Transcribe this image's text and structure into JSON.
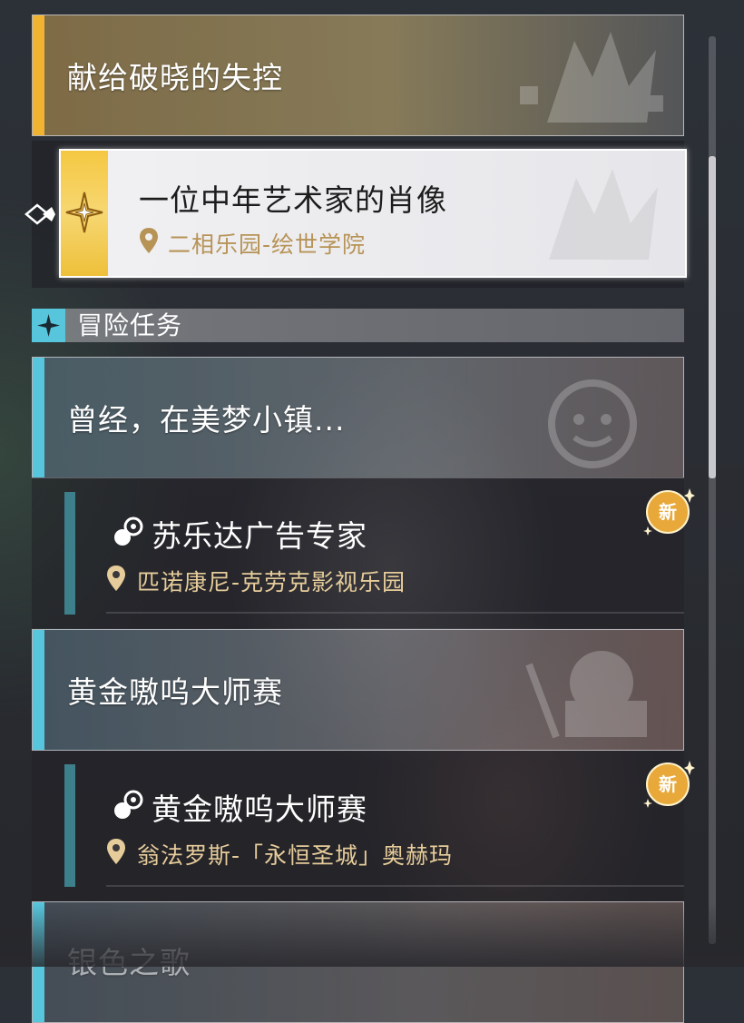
{
  "main_story": {
    "group_title": "献给破晓的失控",
    "selected_quest": {
      "title": "一位中年艺术家的肖像",
      "location": "二相乐园-绘世学院"
    }
  },
  "section": {
    "label": "冒险任务"
  },
  "groups": [
    {
      "title": "曾经，在美梦小镇...",
      "quest": {
        "title": "苏乐达广告专家",
        "location": "匹诺康尼-克劳克影视乐园",
        "badge": "新"
      }
    },
    {
      "title": "黄金嗷呜大师赛",
      "quest": {
        "title": "黄金嗷呜大师赛",
        "location": "翁法罗斯-「永恒圣城」奥赫玛",
        "badge": "新"
      }
    },
    {
      "title": "银色之歌"
    }
  ],
  "colors": {
    "trailblaze_accent": "#f0b432",
    "adventure_accent": "#57c6dc",
    "location_text": "#e6cc9a",
    "sidebar": "#3e7f8c"
  },
  "icons": {
    "pointer": "diamond-pointer-icon",
    "mission_type": "adventure-mission-icon",
    "location": "location-pin-icon",
    "section": "four-point-star-icon"
  }
}
